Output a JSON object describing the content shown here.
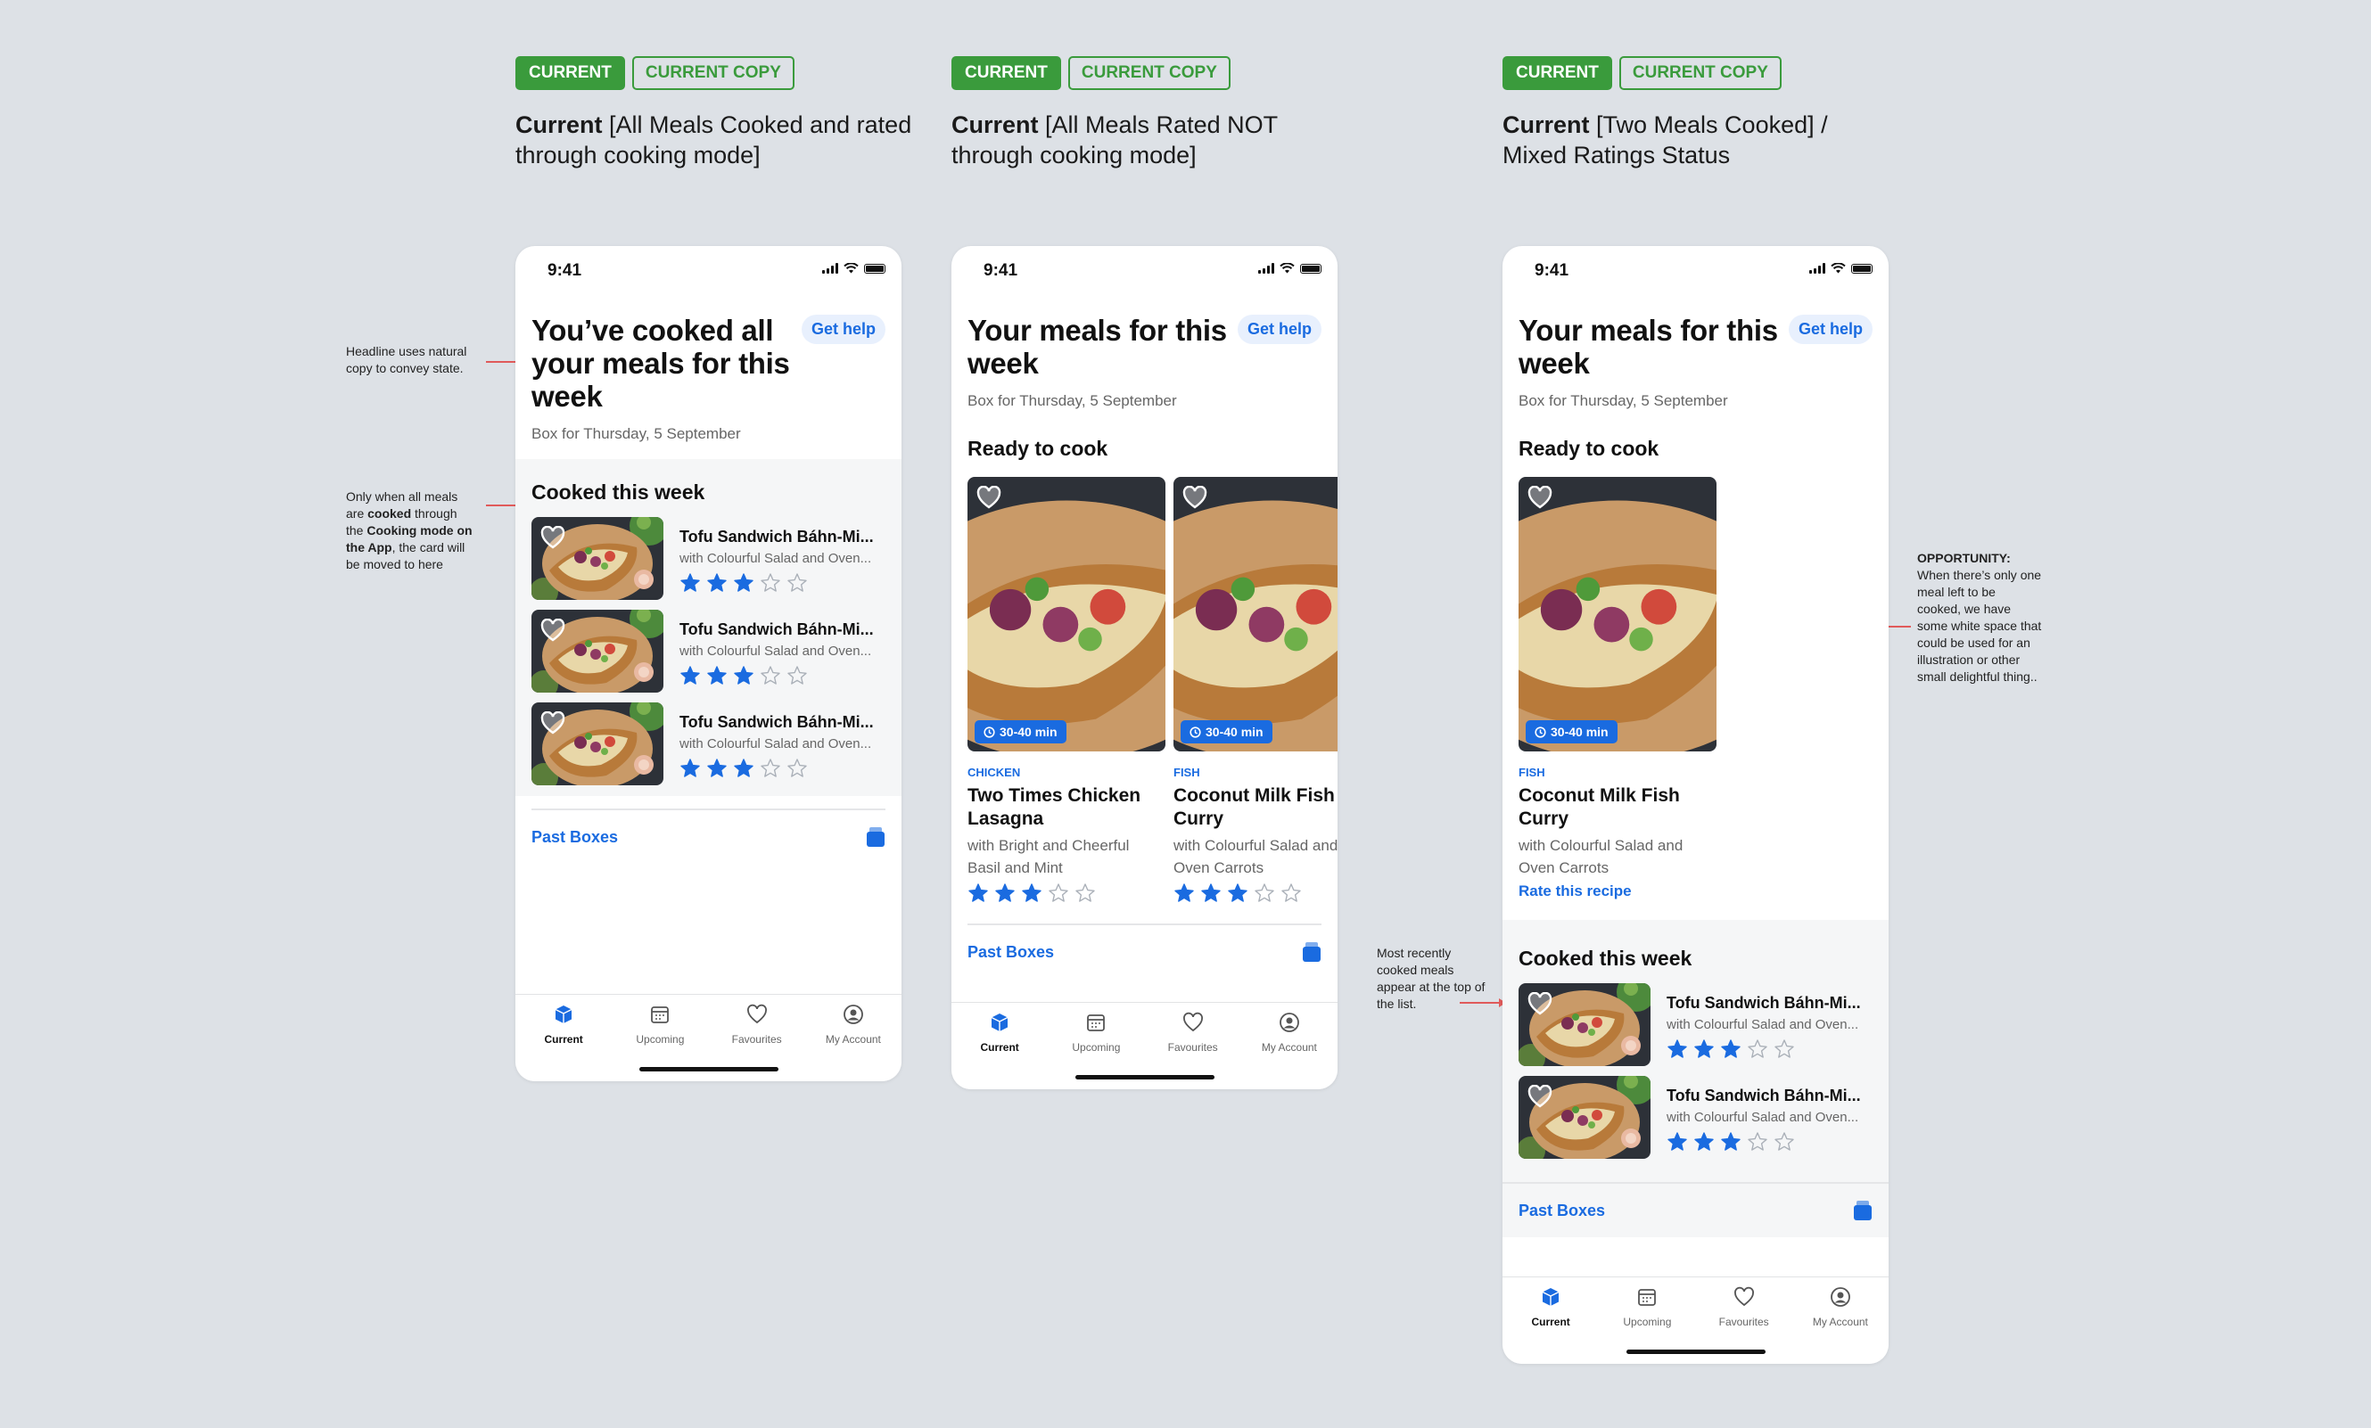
{
  "columns": [
    {
      "tag_current": "CURRENT",
      "tag_copy": "CURRENT COPY",
      "title_bold": "Current",
      "title_rest": " [All Meals Cooked and rated through cooking mode]"
    },
    {
      "tag_current": "CURRENT",
      "tag_copy": "CURRENT COPY",
      "title_bold": "Current",
      "title_rest": " [All Meals Rated NOT through cooking mode]"
    },
    {
      "tag_current": "CURRENT",
      "tag_copy": "CURRENT COPY",
      "title_bold": "Current",
      "title_rest": " [Two Meals Cooked] / Mixed Ratings Status"
    }
  ],
  "status_time": "9:41",
  "help_label": "Get help",
  "box_date": "Box for Thursday, 5 September",
  "past_boxes": "Past Boxes",
  "tabs": [
    "Current",
    "Upcoming",
    "Favourites",
    "My Account"
  ],
  "phone1": {
    "headline": "You’ve cooked all your meals for this week",
    "cooked_title": "Cooked this week",
    "items": [
      {
        "name": "Tofu Sandwich Báhn-Mi...",
        "sub": "with Colourful Salad and Oven...",
        "rating": 3
      },
      {
        "name": "Tofu Sandwich Báhn-Mi...",
        "sub": "with Colourful Salad and Oven...",
        "rating": 3
      },
      {
        "name": "Tofu Sandwich Báhn-Mi...",
        "sub": "with Colourful Salad and Oven...",
        "rating": 3
      }
    ]
  },
  "phone2": {
    "headline": "Your meals for this week",
    "ready_title": "Ready to cook",
    "cards": [
      {
        "time": "30-40 min",
        "category": "CHICKEN",
        "name": "Two Times Chicken Lasagna",
        "sub1": "with Bright and Cheerful",
        "sub2": "Basil and Mint",
        "rating": 3
      },
      {
        "time": "30-40 min",
        "category": "FISH",
        "name": "Coconut Milk Fish Curry",
        "sub1": "with Colourful Salad and",
        "sub2": "Oven Carrots",
        "rating": 3
      }
    ]
  },
  "phone3": {
    "headline": "Your meals for this week",
    "ready_title": "Ready to cook",
    "card": {
      "time": "30-40 min",
      "category": "FISH",
      "name": "Coconut Milk Fish Curry",
      "sub1": "with Colourful Salad and",
      "sub2": "Oven Carrots",
      "rate_label": "Rate this recipe"
    },
    "cooked_title": "Cooked this week",
    "items": [
      {
        "name": "Tofu Sandwich Báhn-Mi...",
        "sub": "with Colourful Salad and Oven...",
        "rating": 3
      },
      {
        "name": "Tofu Sandwich Báhn-Mi...",
        "sub": "with Colourful Salad and Oven...",
        "rating": 3
      }
    ]
  },
  "notes": {
    "headline_note": "Headline uses natural copy to convey state.",
    "cooked_note_1": "Only when all meals are ",
    "cooked_note_bold1": "cooked",
    "cooked_note_2": " through the ",
    "cooked_note_bold2": "Cooking mode on the App",
    "cooked_note_3": ", the  card will be moved to here",
    "recent_note": "Most recently cooked meals appear at the top of the list.",
    "opportunity_title": "OPPORTUNITY:",
    "opportunity_text": "When there’s only one meal left to be cooked, we have some white space that could be used for an illustration or other small delightful thing.."
  },
  "colors": {
    "accent": "#1a6be0",
    "tag_green": "#3a9b3c",
    "annotation_red": "#e05a5a",
    "background": "#dde1e6"
  }
}
